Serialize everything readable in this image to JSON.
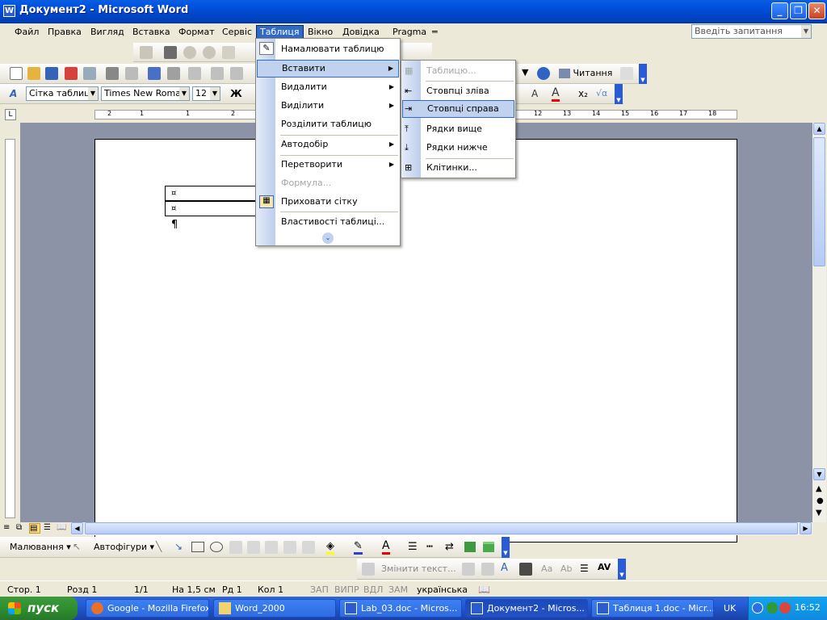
{
  "window": {
    "title": "Документ2 - Microsoft Word"
  },
  "menubar": {
    "items": [
      "Файл",
      "Правка",
      "Вигляд",
      "Вставка",
      "Формат",
      "Сервіс",
      "Таблиця",
      "Вікно",
      "Довідка",
      "Pragma"
    ],
    "help_placeholder": "Введіть запитання"
  },
  "toolbar": {
    "style": "Сітка таблиці",
    "font": "Times New Roman",
    "size": "12",
    "read_label": "Читання",
    "bold": "Ж"
  },
  "table_menu": {
    "items": [
      {
        "label": "Намалювати таблицю"
      },
      {
        "label": "Вставити"
      },
      {
        "label": "Видалити"
      },
      {
        "label": "Виділити"
      },
      {
        "label": "Розділити таблицю"
      },
      {
        "label": "Автодобір"
      },
      {
        "label": "Перетворити"
      },
      {
        "label": "Формула..."
      },
      {
        "label": "Приховати сітку"
      },
      {
        "label": "Властивості таблиці..."
      }
    ]
  },
  "insert_submenu": {
    "items": [
      {
        "label": "Таблицю..."
      },
      {
        "label": "Стовпці зліва"
      },
      {
        "label": "Стовпці справа"
      },
      {
        "label": "Рядки вище"
      },
      {
        "label": "Рядки нижче"
      },
      {
        "label": "Клітинки..."
      }
    ]
  },
  "document": {
    "cell_marker": "¤",
    "para_mark": "¶"
  },
  "drawing_toolbar": {
    "draw_label": "Малювання",
    "autoshapes_label": "Автофігури"
  },
  "wordart_toolbar": {
    "change_text_label": "Змінити текст..."
  },
  "statusbar": {
    "page": "Стор.  1",
    "section": "Розд  1",
    "pages": "1/1",
    "at": "На 1,5 см",
    "line": "Рд  1",
    "col": "Кол  1",
    "rec": "ЗАП",
    "trk": "ВИПР",
    "ext": "ВДЛ",
    "ovr": "ЗАМ",
    "language": "українська"
  },
  "taskbar": {
    "start_label": "пуск",
    "tasks": [
      {
        "label": "Google - Mozilla Firefox"
      },
      {
        "label": "Word_2000"
      },
      {
        "label": "Lab_03.doc - Micros..."
      },
      {
        "label": "Документ2 - Micros..."
      },
      {
        "label": "Таблиця 1.doc - Micr..."
      }
    ],
    "lang": "UK",
    "clock": "16:52"
  },
  "ruler_ticks": [
    "2",
    "1",
    "1",
    "2",
    "12",
    "13",
    "14",
    "15",
    "16",
    "17",
    "18"
  ]
}
